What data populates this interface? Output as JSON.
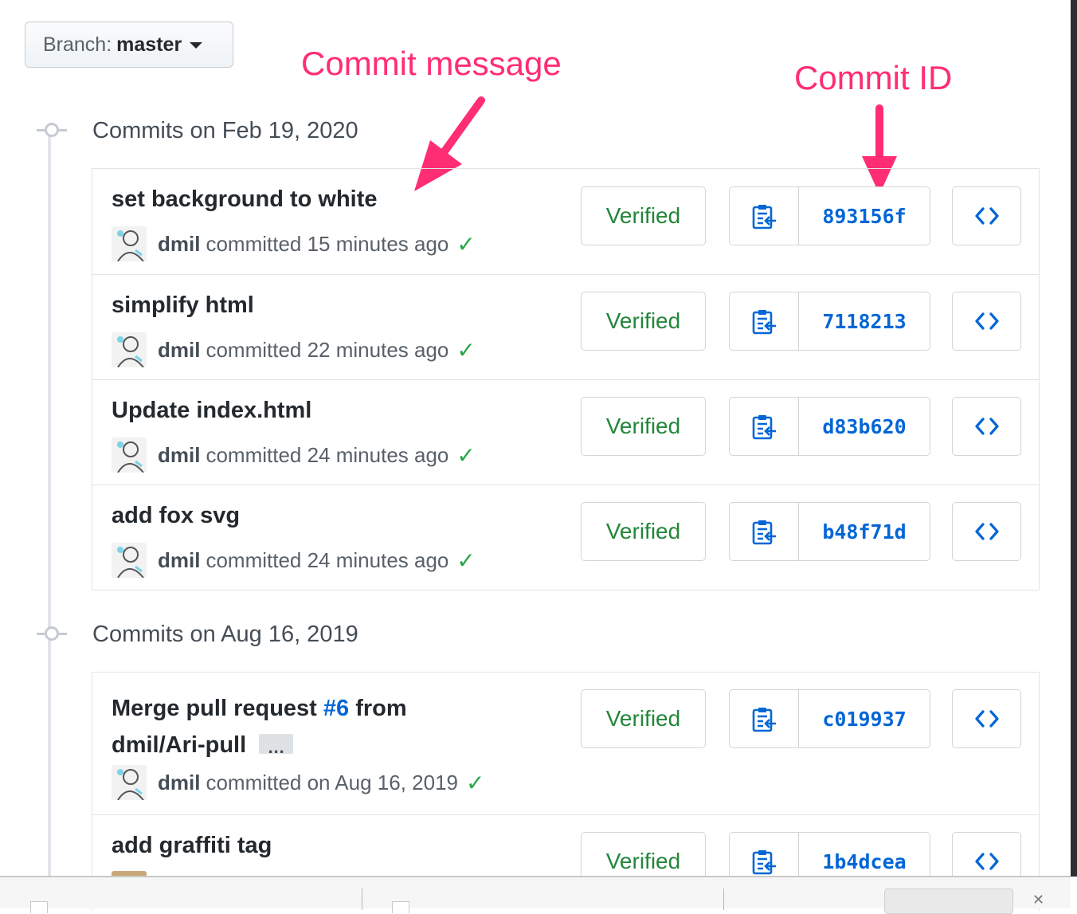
{
  "branch": {
    "label": "Branch:",
    "value": "master"
  },
  "annotations": {
    "commit_message": "Commit message",
    "commit_id": "Commit ID"
  },
  "groups": [
    {
      "date": "Commits on Feb 19, 2020",
      "commits": [
        {
          "message": "set background to white",
          "author": "dmil",
          "committed": "committed 15 minutes ago",
          "verified": "Verified",
          "sha": "893156f"
        },
        {
          "message": "simplify html",
          "author": "dmil",
          "committed": "committed 22 minutes ago",
          "verified": "Verified",
          "sha": "7118213"
        },
        {
          "message": "Update index.html",
          "author": "dmil",
          "committed": "committed 24 minutes ago",
          "verified": "Verified",
          "sha": "d83b620"
        },
        {
          "message": "add fox svg",
          "author": "dmil",
          "committed": "committed 24 minutes ago",
          "verified": "Verified",
          "sha": "b48f71d"
        }
      ]
    },
    {
      "date": "Commits on Aug 16, 2019",
      "commits": [
        {
          "message_prefix": "Merge pull request",
          "pr_link": "#6",
          "message_suffix": "from",
          "message_line2": "dmil/Ari-pull",
          "author": "dmil",
          "committed": "committed on Aug 16, 2019",
          "verified": "Verified",
          "sha": "c019937"
        },
        {
          "message": "add graffiti tag",
          "verified": "Verified",
          "sha": "1b4dcea"
        }
      ]
    }
  ],
  "icons": {
    "copy": "clipboard-copy-icon",
    "browse": "code-brackets-icon",
    "status": "check-icon",
    "dropdown": "caret-down-icon"
  },
  "colors": {
    "annotation": "#ff2d73",
    "link": "#0366d6",
    "verified": "#22863a",
    "check": "#28a745"
  }
}
